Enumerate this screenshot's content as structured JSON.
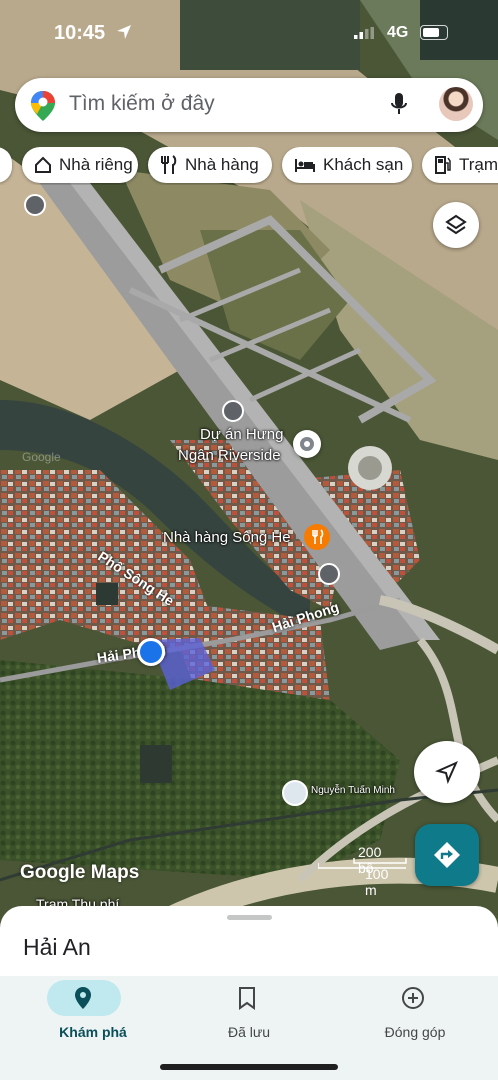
{
  "status_bar": {
    "time": "10:45",
    "network": "4G"
  },
  "search": {
    "placeholder": "Tìm kiếm ở đây"
  },
  "chips": [
    {
      "label": "Nhà riêng",
      "icon": "home-icon"
    },
    {
      "label": "Nhà hàng",
      "icon": "restaurant-icon"
    },
    {
      "label": "Khách sạn",
      "icon": "hotel-icon"
    },
    {
      "label": "Trạm",
      "icon": "gas-station-icon"
    }
  ],
  "map": {
    "places": {
      "riverside_line1": "Dự án Hưng",
      "riverside_line2": "Ngân Riverside",
      "restaurant": "Nhà hàng Sông He",
      "user_label": "Nguyễn Tuấn Minh",
      "toll": "Trạm Thu phí"
    },
    "roads": {
      "pho_song_he": "Phố Sông He",
      "hai_phong_1": "Hải Phong",
      "hai_phong_2": "Hải Phong"
    },
    "watermark": "Google",
    "attribution": "Google Maps",
    "scale": {
      "label_top": "200 bộ",
      "label_bottom": "100 m"
    },
    "colors": {
      "location_dot": "#1a73e8",
      "poi_orange": "#f57c00",
      "directions": "#0e7a8a"
    }
  },
  "sheet": {
    "place_name": "Hải An"
  },
  "bottom_nav": {
    "tabs": [
      {
        "label": "Khám phá",
        "icon": "location-pin-icon",
        "active": true
      },
      {
        "label": "Đã lưu",
        "icon": "bookmark-icon",
        "active": false
      },
      {
        "label": "Đóng góp",
        "icon": "add-circle-icon",
        "active": false
      }
    ]
  }
}
